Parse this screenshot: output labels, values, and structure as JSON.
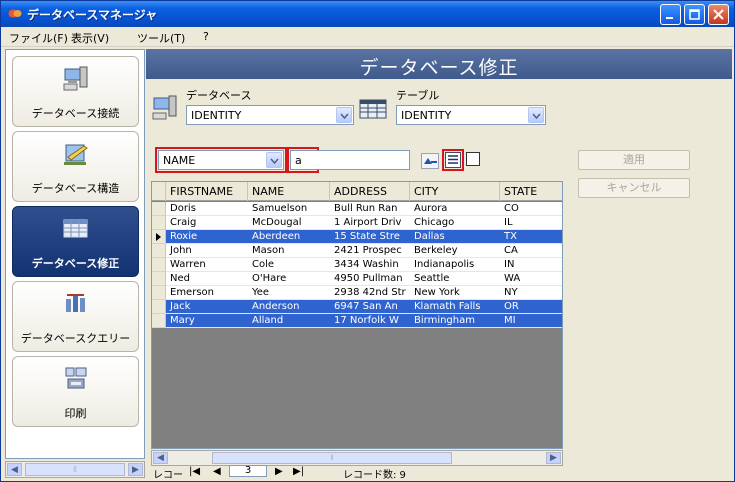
{
  "window": {
    "title": "データベースマネージャ"
  },
  "menu": [
    {
      "label": "ファイル(F)"
    },
    {
      "label": "表示(V)"
    },
    {
      "label": "ツール(T)"
    },
    {
      "label": "?"
    }
  ],
  "nav": [
    {
      "label": "データベース接続",
      "icon": "database-connect-icon"
    },
    {
      "label": "データベース構造",
      "icon": "database-structure-icon"
    },
    {
      "label": "データベース修正",
      "icon": "database-edit-icon",
      "active": true
    },
    {
      "label": "データベースクエリー",
      "icon": "database-query-icon"
    },
    {
      "label": "印刷",
      "icon": "print-icon"
    }
  ],
  "header": {
    "title": "データベース修正"
  },
  "selectors": {
    "database_label": "データベース",
    "database_value": "IDENTITY",
    "table_label": "テーブル",
    "table_value": "IDENTITY"
  },
  "filter": {
    "field_value": "NAME",
    "search_value": "a"
  },
  "actions": {
    "apply_label": "適用",
    "cancel_label": "キャンセル"
  },
  "grid": {
    "columns": [
      "FIRSTNAME",
      "NAME",
      "ADDRESS",
      "CITY",
      "STATE"
    ],
    "rows": [
      {
        "cells": [
          "Doris",
          "Samuelson",
          "Bull Run Ran",
          "Aurora",
          "CO"
        ],
        "selected": false,
        "current": false
      },
      {
        "cells": [
          "Craig",
          "McDougal",
          "1 Airport Driv",
          "Chicago",
          "IL"
        ],
        "selected": false,
        "current": false
      },
      {
        "cells": [
          "Roxie",
          "Aberdeen",
          "15 State Stre",
          "Dallas",
          "TX"
        ],
        "selected": true,
        "current": true
      },
      {
        "cells": [
          "John",
          "Mason",
          "2421 Prospec",
          "Berkeley",
          "CA"
        ],
        "selected": false,
        "current": false
      },
      {
        "cells": [
          "Warren",
          "Cole",
          "3434 Washin",
          "Indianapolis",
          "IN"
        ],
        "selected": false,
        "current": false
      },
      {
        "cells": [
          "Ned",
          "O'Hare",
          "4950 Pullman",
          "Seattle",
          "WA"
        ],
        "selected": false,
        "current": false
      },
      {
        "cells": [
          "Emerson",
          "Yee",
          "2938 42nd Str",
          "New York",
          "NY"
        ],
        "selected": false,
        "current": false
      },
      {
        "cells": [
          "Jack",
          "Anderson",
          "6947 San An",
          "Klamath Falls",
          "OR"
        ],
        "selected": true,
        "current": false
      },
      {
        "cells": [
          "Mary",
          "Alland",
          "17 Norfolk W",
          "Birmingham",
          "MI"
        ],
        "selected": true,
        "current": false
      }
    ]
  },
  "record_nav": {
    "label": "レコー",
    "current": "3",
    "count_label": "レコード数: 9"
  },
  "colors": {
    "title_bar": "#0a5fe0",
    "header_bar": "#4a6496",
    "selection": "#2f64d0",
    "active_nav": "#1c3b7a",
    "highlight_box": "#d8151b"
  }
}
